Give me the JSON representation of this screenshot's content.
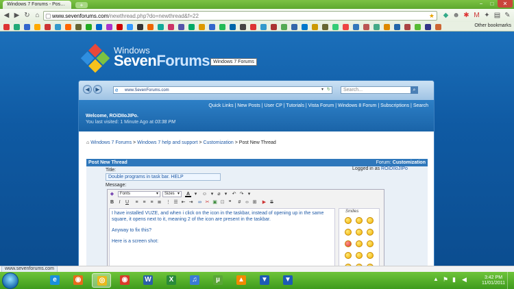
{
  "browser": {
    "tabs": [
      {
        "title": "Windows 7 Forums - Pos…"
      }
    ],
    "new_tab_icon": "plus",
    "window_controls": [
      "−",
      "□",
      "✕"
    ],
    "url": {
      "host": "www.sevenforums.com",
      "path": "/newthread.php?do=newthread&f=22"
    },
    "other_bookmarks": "Other bookmarks",
    "bookmark_colors": [
      "#d33",
      "#2a7",
      "#36c",
      "#fa0",
      "#c33",
      "#39c",
      "#f60",
      "#663",
      "#2a2",
      "#06c",
      "#a3c",
      "#c00",
      "#39f",
      "#333",
      "#e60",
      "#1a9",
      "#c36",
      "#55a",
      "#0a6",
      "#d90",
      "#36c",
      "#2b5",
      "#06a",
      "#444",
      "#d33",
      "#39c",
      "#a33",
      "#5a5",
      "#36a",
      "#07c",
      "#c90",
      "#663",
      "#3c7",
      "#e44",
      "#37b",
      "#b55",
      "#4a8",
      "#d80",
      "#26a",
      "#a44",
      "#5b3",
      "#338",
      "#c63"
    ]
  },
  "site": {
    "logo_top": "Windows",
    "logo_name_a": "Seven",
    "logo_name_b": "Forums",
    "logo_tooltip": "Windows 7 Forums",
    "ie_address": "www.SevenForums.com",
    "ie_search_placeholder": "Search...",
    "quick_links": "Quick Links | New Posts | User CP | Tutorials | Vista Forum | Windows 8 Forum | Subscriptions | Search",
    "welcome": "Welcome, ROiDIIoJIPo.",
    "last_visited_label": "You last visited: 1 Minute Ago at",
    "last_visited_time": "03:38 PM",
    "breadcrumb": {
      "home": "Windows 7 Forums",
      "sep": ">",
      "section": "Windows 7 help and support",
      "forum": "Customization",
      "current": "Post New Thread"
    }
  },
  "post_form": {
    "header": "Post New Thread",
    "forum_label": "Forum:",
    "forum_name": "Customization",
    "title_label": "Title:",
    "title_value": "Double programs in task bar. HELP",
    "logged_in_label": "Logged in as",
    "logged_in_user": "ROiDIIoJIPo",
    "message_label": "Message:",
    "font_select": "Fonts",
    "size_select": "Sizes",
    "body": [
      "I have installed VUZE, and when i click on the icon in the taskbar, instead of opening up in the same square, it opens next to it, meaning 2 of the icon are present in the taskbar.",
      "Anyway to fix this?",
      "Here is a screen shot:"
    ],
    "smilies_title": "Smilies"
  },
  "status_url": "www.sevenforums.com",
  "taskbar": {
    "items": [
      {
        "icon": "internet-explorer-icon",
        "glyph": "e",
        "color": "#1a8fdc"
      },
      {
        "icon": "firefox-icon",
        "glyph": "◉",
        "color": "#e66a1a"
      },
      {
        "icon": "chrome-icon",
        "glyph": "◎",
        "color": "#e9b91d",
        "active": true
      },
      {
        "icon": "chrome-icon",
        "glyph": "◉",
        "color": "#d93b2b"
      },
      {
        "icon": "word-icon",
        "glyph": "W",
        "color": "#2b5fa8"
      },
      {
        "icon": "excel-icon",
        "glyph": "X",
        "color": "#2a8a3a"
      },
      {
        "icon": "itunes-icon",
        "glyph": "♫",
        "color": "#3a7bd5"
      },
      {
        "icon": "utorrent-icon",
        "glyph": "µ",
        "color": "#5aa637"
      },
      {
        "icon": "vlc-icon",
        "glyph": "▲",
        "color": "#f18a00"
      },
      {
        "icon": "vuze-icon",
        "glyph": "▼",
        "color": "#1d5bb5"
      },
      {
        "icon": "vuze-icon",
        "glyph": "▼",
        "color": "#1d5bb5"
      }
    ],
    "time": "3:42 PM",
    "date": "11/01/2011"
  }
}
